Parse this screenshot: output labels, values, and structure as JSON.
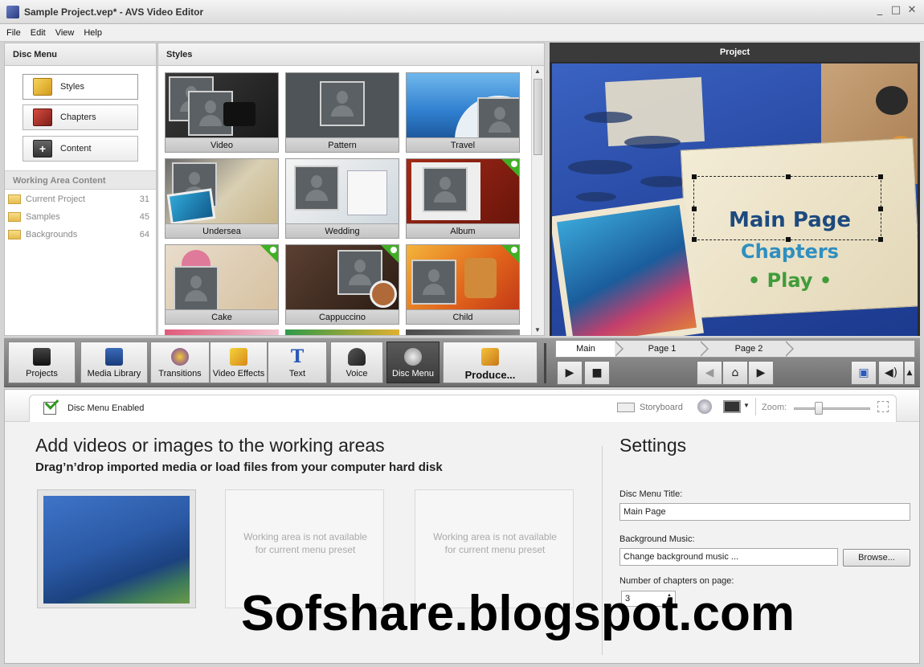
{
  "window": {
    "title": "Sample Project.vep* - AVS Video Editor",
    "controls": [
      "_",
      "□",
      "✕"
    ]
  },
  "menu": [
    "File",
    "Edit",
    "View",
    "Help"
  ],
  "left_panel": {
    "header": "Disc Menu",
    "buttons": [
      "Styles",
      "Chapters",
      "Content"
    ],
    "working_area_header": "Working Area Content",
    "items": [
      {
        "label": "Current Project",
        "count": "31"
      },
      {
        "label": "Samples",
        "count": "45"
      },
      {
        "label": "Backgrounds",
        "count": "64"
      }
    ]
  },
  "styles_panel": {
    "header": "Styles",
    "thumbs": [
      "Video",
      "Pattern",
      "Travel",
      "Undersea",
      "Wedding",
      "Album",
      "Cake",
      "Cappuccino",
      "Child"
    ]
  },
  "project": {
    "header": "Project",
    "menu_items": {
      "main": "Main Page",
      "chapters": "Chapters",
      "play": "• Play •"
    }
  },
  "toolbar": {
    "buttons": [
      "Projects",
      "Media Library",
      "Transitions",
      "Video Effects",
      "Text",
      "Voice",
      "Disc Menu",
      "Produce..."
    ],
    "nav_tabs": [
      "Main",
      "Page 1",
      "Page 2"
    ]
  },
  "bottom": {
    "disc_menu_enabled": "Disc Menu Enabled",
    "storyboard": "Storyboard",
    "zoom": "Zoom:",
    "heading": "Add videos or images to the working areas",
    "subheading": "Drag’n’drop imported media or load files from your computer hard disk",
    "not_available": "Working area is not available for current menu preset"
  },
  "settings": {
    "heading": "Settings",
    "title_label": "Disc Menu Title:",
    "title_value": "Main Page",
    "music_label": "Background Music:",
    "music_value": "Change background music ...",
    "browse_label": "Browse...",
    "chapters_label": "Number of chapters on page:",
    "chapters_value": "3"
  },
  "watermark": "Sofshare.blogspot.com",
  "colors": {
    "menu_text_dark": "#1d4a7e",
    "menu_text_blue": "#2e8fc0",
    "menu_text_green": "#3f9c3a"
  }
}
